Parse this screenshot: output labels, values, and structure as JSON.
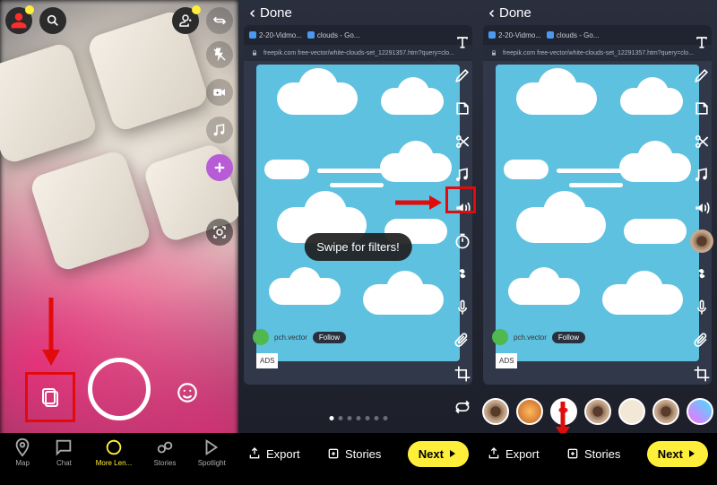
{
  "panel1": {
    "nav": {
      "map": "Map",
      "chat": "Chat",
      "lenses": "More Len...",
      "stories": "Stories",
      "spotlight": "Spotlight"
    }
  },
  "editor": {
    "done": "Done",
    "tabs": {
      "vidmore": "2-20-Vidmo...",
      "clouds": "clouds - Go..."
    },
    "url": "freepik.com free-vector/white-clouds-set_12291357.htm?query=clo...",
    "post": {
      "author": "pch.vector",
      "follow": "Follow"
    },
    "ads": "ADS",
    "tooltip": "Swipe for filters!"
  },
  "bottom": {
    "export": "Export",
    "stories": "Stories",
    "next": "Next"
  }
}
